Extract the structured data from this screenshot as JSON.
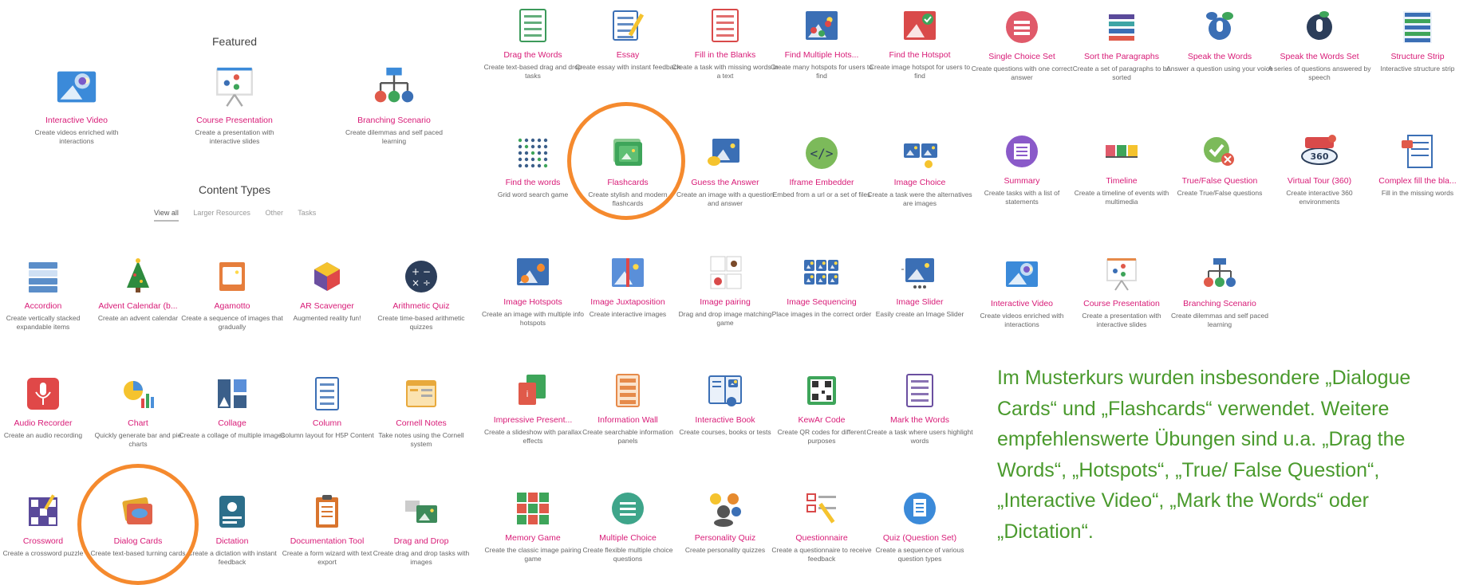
{
  "featured": {
    "heading": "Featured",
    "items": [
      {
        "title": "Interactive Video",
        "desc": "Create videos enriched with interactions",
        "icon": "interactive-video-icon"
      },
      {
        "title": "Course Presentation",
        "desc": "Create a presentation with interactive slides",
        "icon": "course-presentation-icon"
      },
      {
        "title": "Branching Scenario",
        "desc": "Create dilemmas and self paced learning",
        "icon": "branching-scenario-icon"
      }
    ]
  },
  "content_types": {
    "heading": "Content Types",
    "tabs": [
      "View all",
      "Larger Resources",
      "Other",
      "Tasks"
    ],
    "active_tab": "View all"
  },
  "grid": [
    {
      "title": "Accordion",
      "desc": "Create vertically stacked expandable items",
      "icon": "accordion-icon",
      "color": "#5b8ec9"
    },
    {
      "title": "Advent Calendar (b...",
      "desc": "Create an advent calendar",
      "icon": "christmas-tree-icon",
      "color": "#2e8b3e"
    },
    {
      "title": "Agamotto",
      "desc": "Create a sequence of images that gradually",
      "icon": "agamotto-icon",
      "color": "#e67e3c"
    },
    {
      "title": "AR Scavenger",
      "desc": "Augmented reality fun!",
      "icon": "ar-cube-icon",
      "color": "#6b4fa0"
    },
    {
      "title": "Arithmetic Quiz",
      "desc": "Create time-based arithmetic quizzes",
      "icon": "arithmetic-icon",
      "color": "#2c3e5a"
    },
    {
      "title": "Audio Recorder",
      "desc": "Create an audio recording",
      "icon": "microphone-icon",
      "color": "#e04848"
    },
    {
      "title": "Chart",
      "desc": "Quickly generate bar and pie charts",
      "icon": "chart-icon",
      "color": "#4a90d9"
    },
    {
      "title": "Collage",
      "desc": "Create a collage of multiple images",
      "icon": "collage-icon",
      "color": "#3b5f8a"
    },
    {
      "title": "Column",
      "desc": "Column layout for H5P Content",
      "icon": "column-icon",
      "color": "#3b6fb5"
    },
    {
      "title": "Cornell Notes",
      "desc": "Take notes using the Cornell system",
      "icon": "notes-icon",
      "color": "#e8a93c"
    },
    {
      "title": "Crossword",
      "desc": "Create a crossword puzzle",
      "icon": "crossword-icon",
      "color": "#5a4a9a"
    },
    {
      "title": "Dialog Cards",
      "desc": "Create text-based turning cards",
      "icon": "dialog-cards-icon",
      "color": "#e5a92e"
    },
    {
      "title": "Dictation",
      "desc": "Create a dictation with instant feedback",
      "icon": "dictation-icon",
      "color": "#2c6e8a"
    },
    {
      "title": "Documentation Tool",
      "desc": "Create a form wizard with text export",
      "icon": "clipboard-icon",
      "color": "#d9752e"
    },
    {
      "title": "Drag and Drop",
      "desc": "Create drag and drop tasks with images",
      "icon": "drag-drop-icon",
      "color": "#3d8a5a"
    },
    {
      "title": "Drag the Words",
      "desc": "Create text-based drag and drop tasks",
      "icon": "drag-words-icon",
      "color": "#3c9a5a"
    },
    {
      "title": "Essay",
      "desc": "Create essay with instant feedback",
      "icon": "essay-icon",
      "color": "#3b6fb5"
    },
    {
      "title": "Fill in the Blanks",
      "desc": "Create a task with missing words in a text",
      "icon": "fill-blanks-icon",
      "color": "#d94a4a"
    },
    {
      "title": "Find Multiple Hots...",
      "desc": "Create many hotspots for users to find",
      "icon": "multi-hotspot-icon",
      "color": "#3b6fb5"
    },
    {
      "title": "Find the Hotspot",
      "desc": "Create image hotspot for users to find",
      "icon": "hotspot-icon",
      "color": "#d94a4a"
    },
    {
      "title": "Find the words",
      "desc": "Grid word search game",
      "icon": "word-search-icon",
      "color": "#3b5f8a"
    },
    {
      "title": "Flashcards",
      "desc": "Create stylish and modern flashcards",
      "icon": "flashcards-icon",
      "color": "#3ea55a"
    },
    {
      "title": "Guess the Answer",
      "desc": "Create an image with a question and answer",
      "icon": "guess-answer-icon",
      "color": "#3b6fb5"
    },
    {
      "title": "Iframe Embedder",
      "desc": "Embed from a url or a set of files",
      "icon": "iframe-icon",
      "color": "#7cba5a"
    },
    {
      "title": "Image Choice",
      "desc": "Create a task were the alternatives are images",
      "icon": "image-choice-icon",
      "color": "#3b6fb5"
    },
    {
      "title": "Image Hotspots",
      "desc": "Create an image with multiple info hotspots",
      "icon": "image-hotspots-icon",
      "color": "#3b6fb5"
    },
    {
      "title": "Image Juxtaposition",
      "desc": "Create interactive images",
      "icon": "juxtaposition-icon",
      "color": "#5a8fd9"
    },
    {
      "title": "Image pairing",
      "desc": "Drag and drop image matching game",
      "icon": "image-pairing-icon",
      "color": "#d94a4a"
    },
    {
      "title": "Image Sequencing",
      "desc": "Place images in the correct order",
      "icon": "image-sequencing-icon",
      "color": "#3b6fb5"
    },
    {
      "title": "Image Slider",
      "desc": "Easily create an Image Slider",
      "icon": "image-slider-icon",
      "color": "#3b6fb5"
    },
    {
      "title": "Impressive Present...",
      "desc": "Create a slideshow with parallax effects",
      "icon": "impress-icon",
      "color": "#3ea55a"
    },
    {
      "title": "Information Wall",
      "desc": "Create searchable information panels",
      "icon": "info-wall-icon",
      "color": "#e68a4a"
    },
    {
      "title": "Interactive Book",
      "desc": "Create courses, books or tests",
      "icon": "book-icon",
      "color": "#3b6fb5"
    },
    {
      "title": "KewAr Code",
      "desc": "Create QR codes for different purposes",
      "icon": "qr-code-icon",
      "color": "#3ea55a"
    },
    {
      "title": "Mark the Words",
      "desc": "Create a task where users highlight words",
      "icon": "mark-words-icon",
      "color": "#6b4fa0"
    },
    {
      "title": "Memory Game",
      "desc": "Create the classic image pairing game",
      "icon": "memory-icon",
      "color": "#3ea55a"
    },
    {
      "title": "Multiple Choice",
      "desc": "Create flexible multiple choice questions",
      "icon": "multiple-choice-icon",
      "color": "#3ea58a"
    },
    {
      "title": "Personality Quiz",
      "desc": "Create personality quizzes",
      "icon": "personality-icon",
      "color": "#e68a2e"
    },
    {
      "title": "Questionnaire",
      "desc": "Create a questionnaire to receive feedback",
      "icon": "questionnaire-icon",
      "color": "#d94a4a"
    },
    {
      "title": "Quiz (Question Set)",
      "desc": "Create a sequence of various question types",
      "icon": "quiz-icon",
      "color": "#3b8ad9"
    },
    {
      "title": "Single Choice Set",
      "desc": "Create questions with one correct answer",
      "icon": "single-choice-icon",
      "color": "#e05a6a"
    },
    {
      "title": "Sort the Paragraphs",
      "desc": "Create a set of paragraphs to be sorted",
      "icon": "sort-paragraphs-icon",
      "color": "#5a4a9a"
    },
    {
      "title": "Speak the Words",
      "desc": "Answer a question using your voice",
      "icon": "speak-icon",
      "color": "#3b6fb5"
    },
    {
      "title": "Speak the Words Set",
      "desc": "A series of questions answered by speech",
      "icon": "speak-set-icon",
      "color": "#2c3e5a"
    },
    {
      "title": "Structure Strip",
      "desc": "Interactive structure strip",
      "icon": "structure-strip-icon",
      "color": "#3b6fb5"
    },
    {
      "title": "Summary",
      "desc": "Create tasks with a list of statements",
      "icon": "summary-icon",
      "color": "#8a5ac9"
    },
    {
      "title": "Timeline",
      "desc": "Create a timeline of events with multimedia",
      "icon": "timeline-icon",
      "color": "#e05a6a"
    },
    {
      "title": "True/False Question",
      "desc": "Create True/False questions",
      "icon": "true-false-icon",
      "color": "#7cba5a"
    },
    {
      "title": "Virtual Tour (360)",
      "desc": "Create interactive 360 environments",
      "icon": "virtual-tour-icon",
      "color": "#d94a4a"
    },
    {
      "title": "Complex fill the bla...",
      "desc": "Fill in the missing words",
      "icon": "complex-fill-icon",
      "color": "#e05a4a"
    },
    {
      "title": "Interactive Video",
      "desc": "Create videos enriched with interactions",
      "icon": "interactive-video-icon",
      "color": "#3b8ad9"
    },
    {
      "title": "Course Presentation",
      "desc": "Create a presentation with interactive slides",
      "icon": "course-presentation-icon",
      "color": "#e68a4a"
    },
    {
      "title": "Branching Scenario",
      "desc": "Create dilemmas and self paced learning",
      "icon": "branching-scenario-icon",
      "color": "#3b6fb5"
    }
  ],
  "note": "Im Musterkurs wurden insbesondere „Dialogue Cards“ und „Flashcards“ verwendet. Weitere empfehlenswerte Übungen sind u.a. „Drag the Words“, „Hotspots“, „True/ False Question“, „Interactive Video“, „Mark the Words“ oder „Dictation“.",
  "colors": {
    "title": "#d81b77",
    "note": "#4a9a2d",
    "highlight_ring": "#f58a2e"
  }
}
